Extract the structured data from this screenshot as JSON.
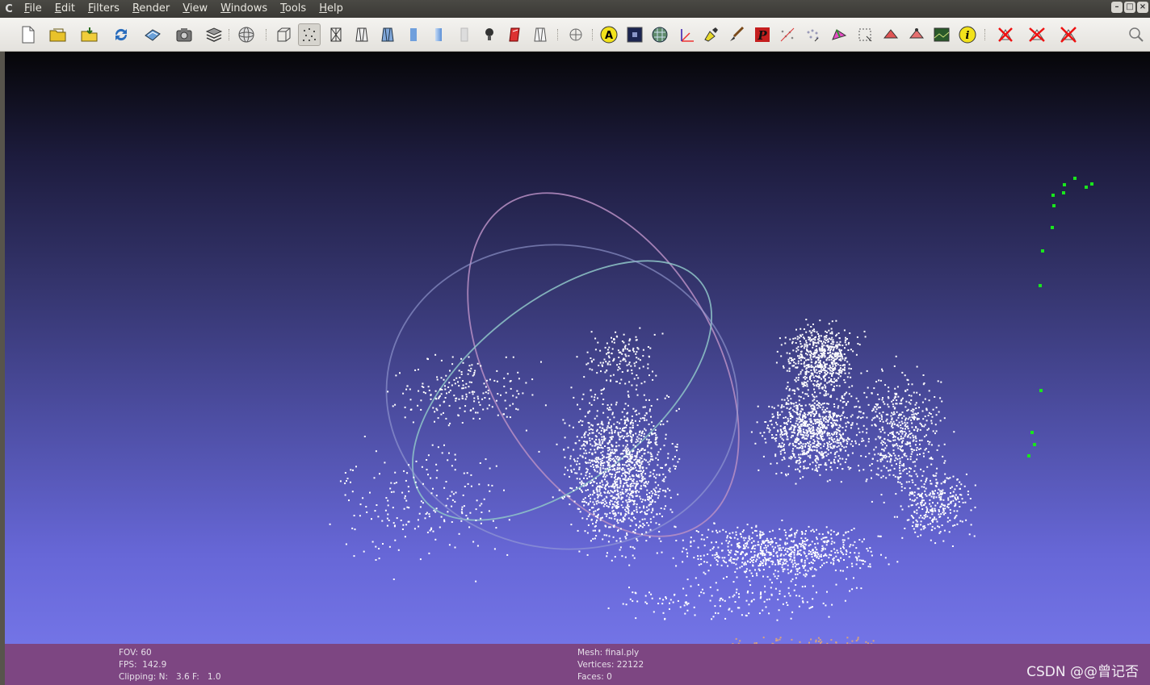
{
  "menubar": {
    "app_logo": "C",
    "items": [
      "File",
      "Edit",
      "Filters",
      "Render",
      "View",
      "Windows",
      "Tools",
      "Help"
    ],
    "window_controls": [
      "minimize-icon",
      "maximize-icon",
      "close-icon"
    ]
  },
  "toolbar": {
    "icons": [
      "new-project-icon",
      "open-project-icon",
      "import-mesh-icon",
      "reload-icon",
      "save-icon",
      "snapshot-icon",
      "layers-icon",
      "trackball-icon",
      "bbox-render-icon",
      "points-render-icon",
      "wireframe-render-icon",
      "hiddenlines-render-icon",
      "flatlines-render-icon",
      "flat-render-icon",
      "smooth-render-icon",
      "texture-render-icon",
      "light-icon",
      "backface-icon",
      "double-side-icon",
      "axis-toggle-icon",
      "annotate-icon",
      "shader-icon",
      "raster-icon",
      "measure-icon",
      "color-paint-icon",
      "brush-icon",
      "pdf-icon",
      "align-icon",
      "manipulate-icon",
      "mesh-paint-icon",
      "select-faces-icon",
      "select-vertices-icon",
      "select-connected-icon",
      "image-align-icon",
      "info-icon",
      "delete-faces-icon",
      "delete-vertices-icon",
      "delete-all-icon",
      "search-icon"
    ]
  },
  "status": {
    "fov": "FOV: 60",
    "fps": "FPS:  142.9",
    "clipping": "Clipping: N:   3.6 F:   1.0",
    "mesh": "Mesh: final.ply",
    "vertices": "Vertices: 22122",
    "faces": "Faces: 0"
  },
  "watermark": "CSDN @@曾记否",
  "colors": {
    "point_cloud": "#ffffff",
    "camera_points": "#19e61d",
    "status_bar": "#7d4682"
  }
}
